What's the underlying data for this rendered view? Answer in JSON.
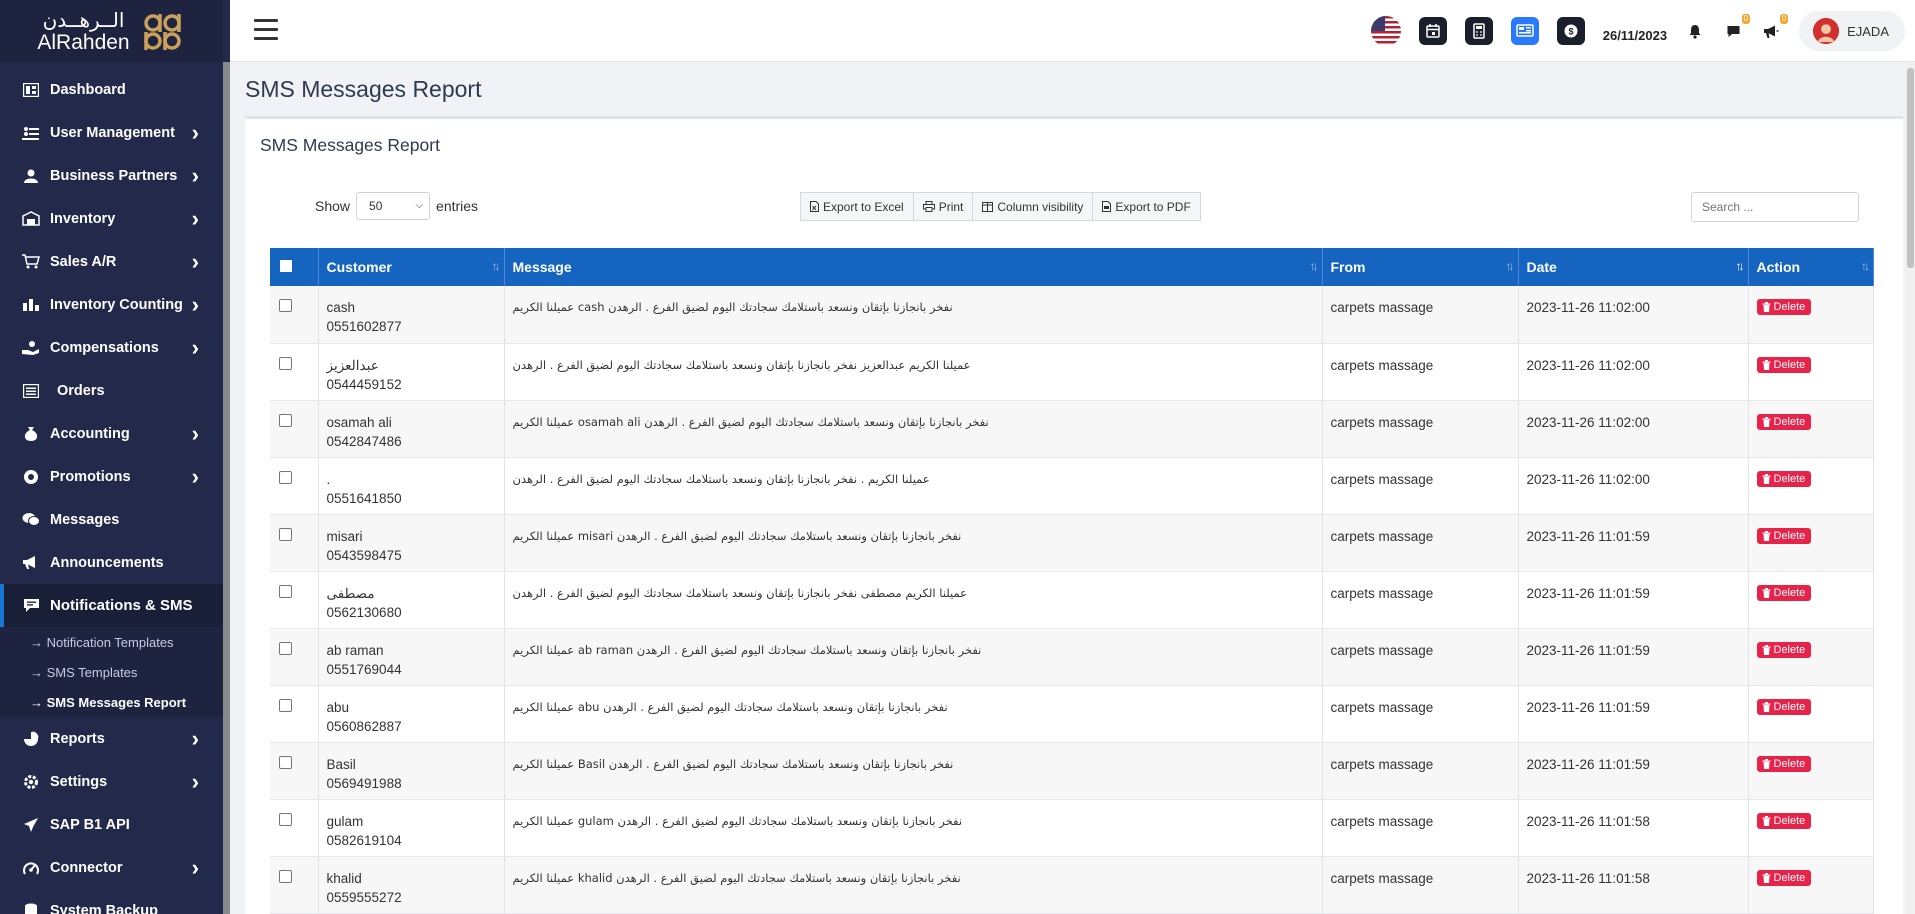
{
  "brand": {
    "arabic": "الــرهــدن",
    "english": "AlRahden"
  },
  "sidebar": {
    "items": [
      {
        "label": "Dashboard",
        "icon": "dashboard-icon",
        "chevron": false
      },
      {
        "label": "User Management",
        "icon": "users-icon",
        "chevron": true
      },
      {
        "label": "Business Partners",
        "icon": "partner-icon",
        "chevron": true
      },
      {
        "label": "Inventory",
        "icon": "inventory-icon",
        "chevron": true
      },
      {
        "label": "Sales A/R",
        "icon": "cart-icon",
        "chevron": true
      },
      {
        "label": "Inventory Counting",
        "icon": "counting-icon",
        "chevron": true
      },
      {
        "label": "Compensations",
        "icon": "compensation-icon",
        "chevron": true
      },
      {
        "label": "Orders",
        "icon": "orders-icon",
        "chevron": false
      },
      {
        "label": "Accounting",
        "icon": "accounting-icon",
        "chevron": true
      },
      {
        "label": "Promotions",
        "icon": "promotions-icon",
        "chevron": true
      },
      {
        "label": "Messages",
        "icon": "messages-icon",
        "chevron": false
      },
      {
        "label": "Announcements",
        "icon": "megaphone-icon",
        "chevron": false
      },
      {
        "label": "Notifications & SMS",
        "icon": "notifications-icon",
        "chevron": false,
        "active": true
      }
    ],
    "subitems": [
      {
        "label": "→ Notification Templates"
      },
      {
        "label": "→ SMS Templates"
      },
      {
        "label": "→ SMS Messages Report",
        "current": true
      }
    ],
    "items_after": [
      {
        "label": "Reports",
        "icon": "reports-icon",
        "chevron": true
      },
      {
        "label": "Settings",
        "icon": "settings-icon",
        "chevron": true
      },
      {
        "label": "SAP B1 API",
        "icon": "plane-icon",
        "chevron": false
      },
      {
        "label": "Connector",
        "icon": "connector-icon",
        "chevron": true
      },
      {
        "label": "System Backup",
        "icon": "backup-icon",
        "chevron": false
      }
    ]
  },
  "topbar": {
    "date": "26/11/2023",
    "messages_badge": "0",
    "announcements_badge": "0",
    "user_name": "EJADA"
  },
  "page": {
    "title": "SMS Messages Report",
    "card_title": "SMS Messages Report"
  },
  "controls": {
    "show_label": "Show",
    "entries_value": "50",
    "entries_label": "entries",
    "buttons": [
      "Export to Excel",
      "Print",
      "Column visibility",
      "Export to PDF"
    ],
    "search_placeholder": "Search ..."
  },
  "table": {
    "columns": [
      "Customer",
      "Message",
      "From",
      "Date",
      "Action"
    ],
    "delete_label": "Delete",
    "rows": [
      {
        "name": "cash",
        "phone": "0551602877",
        "message": "نفخر بانجازنا بإتقان ونسعد باستلامك سجادتك اليوم لضيق الفرع . الرهدن cash عميلنا الكريم",
        "from": "carpets massage",
        "date": "2023-11-26 11:02:00"
      },
      {
        "name": "عبدالعزيز",
        "phone": "0544459152",
        "message": "عميلنا الكريم عبدالعزيز نفخر بانجازنا بإتقان ونسعد باستلامك سجادتك اليوم لضيق الفرع . الرهدن",
        "from": "carpets massage",
        "date": "2023-11-26 11:02:00"
      },
      {
        "name": "osamah ali",
        "phone": "0542847486",
        "message": "نفخر بانجازنا بإتقان ونسعد باستلامك سجادتك اليوم لضيق الفرع . الرهدن osamah ali عميلنا الكريم",
        "from": "carpets massage",
        "date": "2023-11-26 11:02:00"
      },
      {
        "name": ".",
        "phone": "0551641850",
        "message": "عميلنا الكريم . نفخر بانجازنا بإتقان ونسعد باستلامك سجادتك اليوم لضيق الفرع . الرهدن",
        "from": "carpets massage",
        "date": "2023-11-26 11:02:00"
      },
      {
        "name": "misari",
        "phone": "0543598475",
        "message": "نفخر بانجازنا بإتقان ونسعد باستلامك سجادتك اليوم لضيق الفرع . الرهدن misari عميلنا الكريم",
        "from": "carpets massage",
        "date": "2023-11-26 11:01:59"
      },
      {
        "name": "مصطفى",
        "phone": "0562130680",
        "message": "عميلنا الكريم مصطفى نفخر بانجازنا بإتقان ونسعد باستلامك سجادتك اليوم لضيق الفرع . الرهدن",
        "from": "carpets massage",
        "date": "2023-11-26 11:01:59"
      },
      {
        "name": "ab raman",
        "phone": "0551769044",
        "message": "نفخر بانجازنا بإتقان ونسعد باستلامك سجادتك اليوم لضيق الفرع . الرهدن ab raman عميلنا الكريم",
        "from": "carpets massage",
        "date": "2023-11-26 11:01:59"
      },
      {
        "name": "abu",
        "phone": "0560862887",
        "message": "نفخر بانجازنا بإتقان ونسعد باستلامك سجادتك اليوم لضيق الفرع . الرهدن abu عميلنا الكريم",
        "from": "carpets massage",
        "date": "2023-11-26 11:01:59"
      },
      {
        "name": "Basil",
        "phone": "0569491988",
        "message": "نفخر بانجازنا بإتقان ونسعد باستلامك سجادتك اليوم لضيق الفرع . الرهدن Basil عميلنا الكريم",
        "from": "carpets massage",
        "date": "2023-11-26 11:01:59"
      },
      {
        "name": "gulam",
        "phone": "0582619104",
        "message": "نفخر بانجازنا بإتقان ونسعد باستلامك سجادتك اليوم لضيق الفرع . الرهدن gulam عميلنا الكريم",
        "from": "carpets massage",
        "date": "2023-11-26 11:01:58"
      },
      {
        "name": "khalid",
        "phone": "0559555272",
        "message": "نفخر بانجازنا بإتقان ونسعد باستلامك سجادتك اليوم لضيق الفرع . الرهدن khalid عميلنا الكريم",
        "from": "carpets massage",
        "date": "2023-11-26 11:01:58"
      }
    ]
  }
}
